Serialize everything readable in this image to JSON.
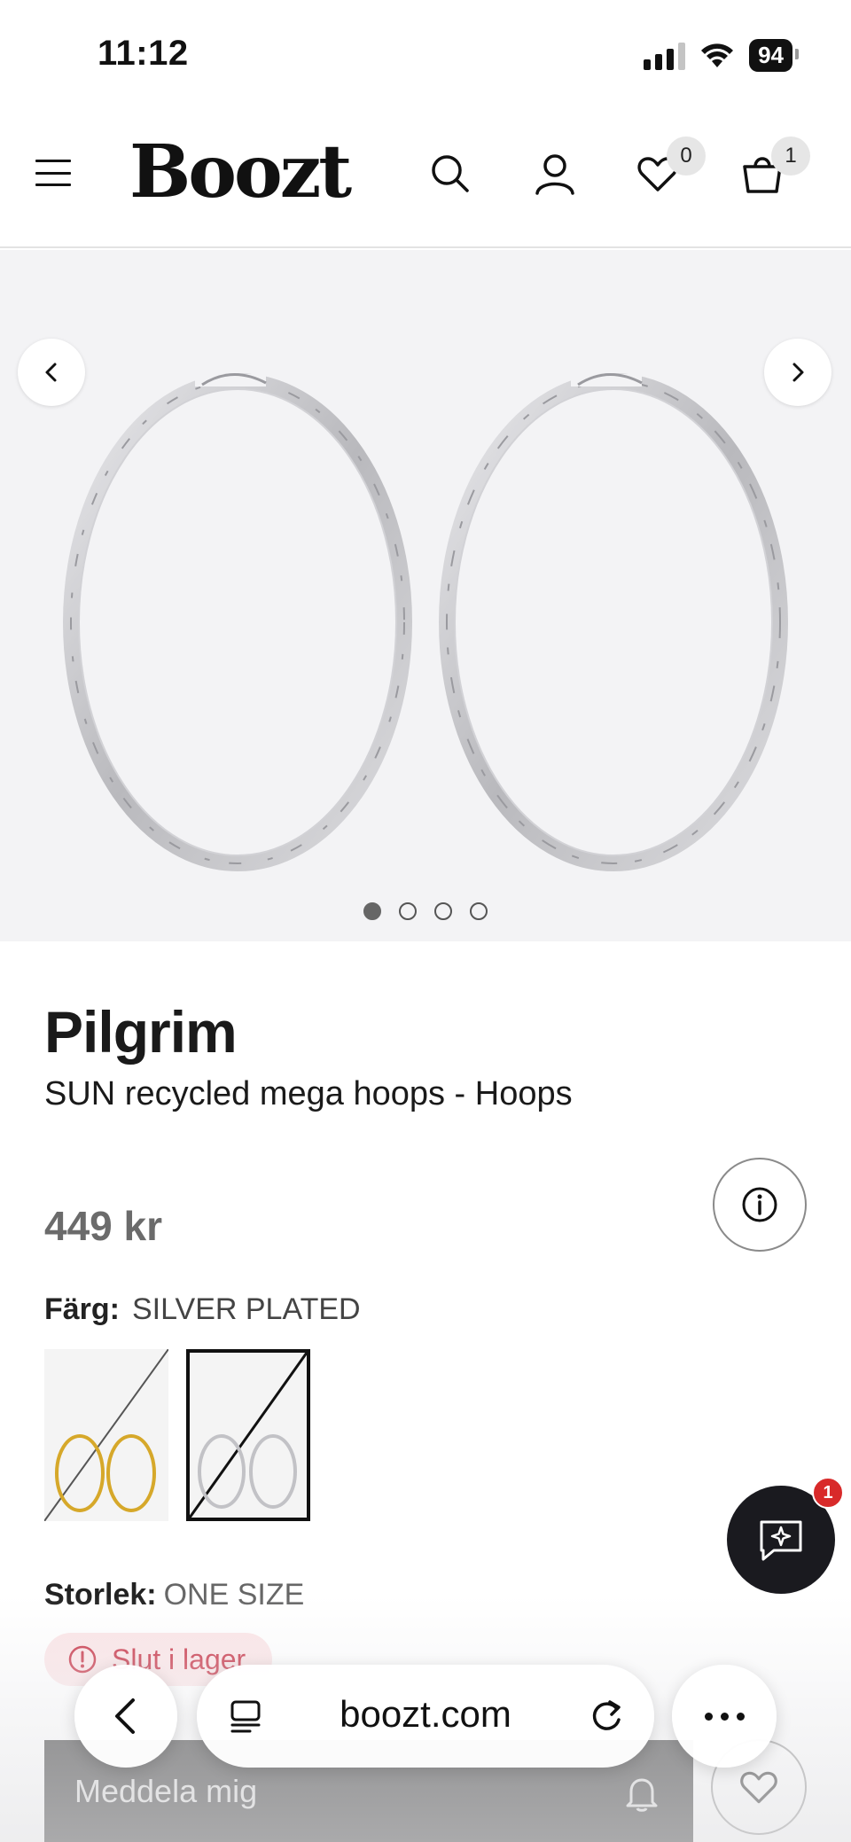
{
  "status_bar": {
    "time": "11:12",
    "battery": "94"
  },
  "header": {
    "logo": "Boozt",
    "wishlist_count": "0",
    "cart_count": "1",
    "icons": [
      "menu-icon",
      "search-icon",
      "account-icon",
      "heart-icon",
      "cart-icon"
    ]
  },
  "gallery": {
    "image_count": 4,
    "active_index": 0
  },
  "product": {
    "brand": "Pilgrim",
    "name": "SUN recycled mega hoops - Hoops",
    "price": "449 kr",
    "color_label": "Färg:",
    "color_value": "SILVER PLATED",
    "swatches": [
      "gold",
      "silver"
    ],
    "selected_swatch": "silver",
    "size_label": "Storlek:",
    "size_value": "ONE SIZE",
    "stock_status": "Slut i lager"
  },
  "actions": {
    "notify_label": "Meddela mig"
  },
  "chat": {
    "badge": "1"
  },
  "browser": {
    "url": "boozt.com"
  },
  "colors": {
    "brand_dark": "#1c1c1c",
    "stock_red": "#c4283c",
    "chat_badge": "#d82a2a"
  }
}
